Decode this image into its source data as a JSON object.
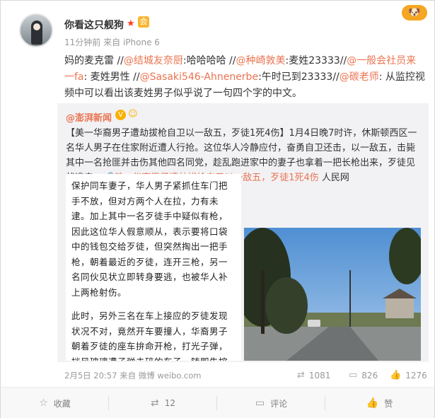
{
  "post": {
    "author": "你看这只舰狗",
    "badge_star": "★",
    "badge_member": "会",
    "time": "11分钟前",
    "source_prefix": "来自",
    "source": "iPhone 6",
    "text_1": "妈的麦克雷 //",
    "mention_1": "@结城友奈厨",
    "text_2": ":哈哈哈哈 //",
    "mention_2": "@种崎敦美",
    "text_3": ":麦姓23333//",
    "mention_3": "@一般会社员来一fa",
    "text_4": ": 麦姓男性 //",
    "mention_4": "@Sasaki546-Ahnenerbe",
    "text_5": ":午时已到23333//",
    "mention_5": "@碳老师",
    "text_6": ": 从监控视频中可以看出该麦姓男子似乎说了一句四个字的中文。"
  },
  "repost": {
    "author": "@澎湃新闻",
    "verified": "V",
    "emoji": "☺",
    "text_1": "【美一华裔男子遭劫拔枪自卫以一敌五，歹徒1死4伤】1月4日晚7时许，休斯顿西区一名华人男子在住家附近遭人行抢。这位华人冷静应付，奋勇自卫还击，以一敌五，击毙其中一名抢匪并击伤其他四名同党，趁乱跑进家中的妻子也拿着一把长枪出来，歹徒见状逃走。",
    "link": "🔗美一华裔男子遭劫拔枪自卫以一敌五，歹徒1死4伤",
    "link_source": "人民网",
    "article_p1": "保护同车妻子，华人男子紧抓住车门把手不放，但对方两个人在拉，力有未逮。加上其中一名歹徒手中疑似有枪，因此这位华人假意顺从，表示要将口袋中的钱包交给歹徒，但突然掏出一把手枪，朝着最近的歹徒，连开三枪，另一名同伙见状立即转身要逃，也被华人补上两枪射伤。",
    "article_p2": "此时，另外三名在车上接应的歹徒发现状况不对，竟然开车要撞人，华裔男子朝着歹徒的座车拚命开枪，打光子弹，挡风玻璃遭子弹击碎的车子，随即失控撞上停在路旁的车辆后翻覆，趁乱跑进家中的妻子",
    "date": "2月5日 20:57",
    "source_prefix": "来自",
    "source": "微博 weibo.com",
    "reposts": "1081",
    "comments": "826",
    "likes": "1276"
  },
  "actions": {
    "favorite": "收藏",
    "repost_count": "12",
    "comment": "评论",
    "like": "赞"
  },
  "icons": {
    "favorite": "star-outline-icon",
    "repost": "repost-arrows-icon",
    "comment": "comment-bubble-icon",
    "like": "thumbs-up-icon",
    "corner": "dog-icon"
  },
  "colors": {
    "link": "#eb7350",
    "meta": "#999999",
    "repost_bg": "#f2f2f5"
  }
}
